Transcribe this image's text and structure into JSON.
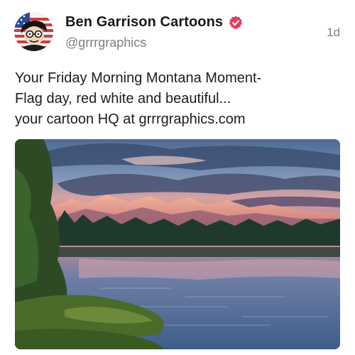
{
  "author": {
    "display_name": "Ben Garrison Cartoons",
    "handle": "@grrrgraphics",
    "avatar_icon": "flag-caricature-avatar",
    "verified_icon": "verified-badge-icon",
    "verified_color": "#e0405f"
  },
  "post": {
    "timestamp": "1d",
    "text_lines": [
      "Your Friday Morning Montana Moment-",
      "Flag day, red white and beautiful...",
      "your cartoon HQ at grrrgraphics.com"
    ],
    "media": {
      "icon": "mountain-lake-photo"
    }
  },
  "colors": {
    "text": "#1c1c1e",
    "muted": "#7b7f86"
  }
}
